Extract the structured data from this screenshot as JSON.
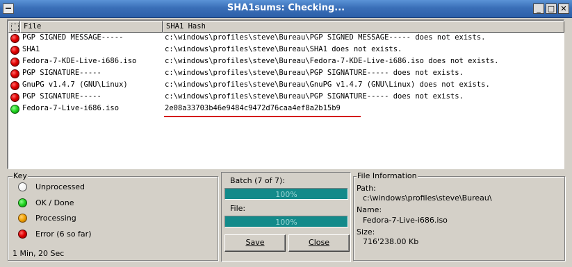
{
  "window": {
    "title": "SHA1sums: Checking...",
    "controls": {
      "minimize": "_",
      "maximize": "□",
      "close": "✕"
    }
  },
  "list": {
    "columns": {
      "file": "File",
      "hash": "SHA1 Hash"
    },
    "rows": [
      {
        "status": "error",
        "file": "PGP SIGNED MESSAGE-----",
        "hash": "c:\\windows\\profiles\\steve\\Bureau\\PGP SIGNED MESSAGE----- does not exists."
      },
      {
        "status": "error",
        "file": "SHA1",
        "hash": "c:\\windows\\profiles\\steve\\Bureau\\SHA1 does not exists."
      },
      {
        "status": "error",
        "file": "Fedora-7-KDE-Live-i686.iso",
        "hash": "c:\\windows\\profiles\\steve\\Bureau\\Fedora-7-KDE-Live-i686.iso does not exists."
      },
      {
        "status": "error",
        "file": "PGP SIGNATURE-----",
        "hash": "c:\\windows\\profiles\\steve\\Bureau\\PGP SIGNATURE----- does not exists."
      },
      {
        "status": "error",
        "file": "GnuPG v1.4.7 (GNU\\Linux)",
        "hash": "c:\\windows\\profiles\\steve\\Bureau\\GnuPG v1.4.7 (GNU\\Linux) does not exists."
      },
      {
        "status": "error",
        "file": "PGP SIGNATURE-----",
        "hash": "c:\\windows\\profiles\\steve\\Bureau\\PGP SIGNATURE----- does not exists."
      },
      {
        "status": "ok",
        "file": "Fedora-7-Live-i686.iso",
        "hash": "2e08a33703b46e9484c9472d76caa4ef8a2b15b9"
      }
    ]
  },
  "key": {
    "title": "Key",
    "items": [
      {
        "color": "white",
        "label": "Unprocessed"
      },
      {
        "color": "green",
        "label": "OK / Done"
      },
      {
        "color": "orange",
        "label": "Processing"
      },
      {
        "color": "red",
        "label": "Error  (6 so far)"
      }
    ],
    "elapsed": "1 Min, 20 Sec"
  },
  "progress": {
    "batch_label": "Batch (7 of 7):",
    "batch_text": "100%",
    "batch_value": 1.0,
    "file_label": "File:",
    "file_text": "100%",
    "file_value": 1.0
  },
  "buttons": {
    "save": "Save",
    "close": "Close"
  },
  "file_info": {
    "title": "File Information",
    "path_label": "Path:",
    "path_value": "c:\\windows\\profiles\\steve\\Bureau\\",
    "name_label": "Name:",
    "name_value": "Fedora-7-Live-i686.iso",
    "size_label": "Size:",
    "size_value": "716'238.00 Kb"
  },
  "colors": {
    "title_bar": "#3a6fb8",
    "progress_fill": "#138a8a",
    "error": "#e00000",
    "ok": "#1ed21e",
    "hash_underline": "#d40000"
  }
}
